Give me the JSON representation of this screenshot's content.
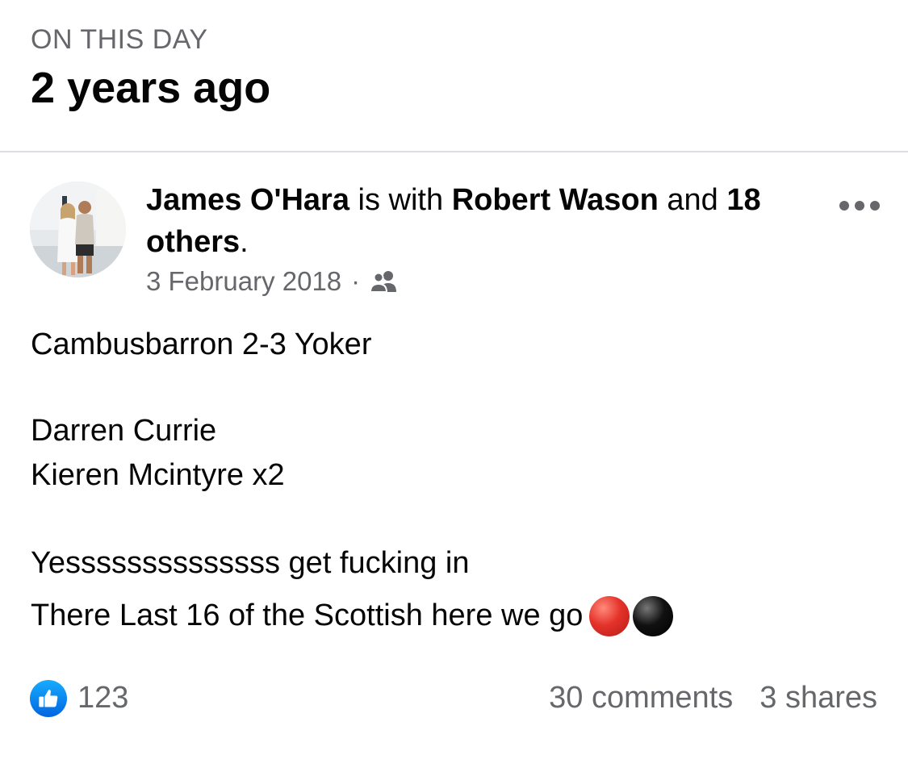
{
  "header": {
    "kicker": "ON THIS DAY",
    "title": "2 years ago"
  },
  "post": {
    "author": "James O'Hara",
    "with_text": "is with",
    "tagged_name": "Robert Wason",
    "and_text": "and",
    "others": "18 others",
    "period": ".",
    "date": "3 February 2018",
    "separator": "·",
    "audience_icon": "friends-icon",
    "more_icon": "more-options-icon",
    "lines": {
      "score": "Cambusbarron 2-3 Yoker",
      "scorer1": "Darren Currie",
      "scorer2": "Kieren Mcintyre x2",
      "cheer": "Yessssssssssssss get fucking in",
      "last": "There  Last 16 of the Scottish here we go"
    },
    "emojis": [
      "red-circle",
      "black-circle"
    ]
  },
  "reactions": {
    "icon": "like-thumb-icon",
    "count": "123",
    "comments": "30 comments",
    "shares": "3 shares"
  },
  "colors": {
    "secondary_text": "#65676b",
    "divider": "#dadde1",
    "like_blue": "#0165e1"
  }
}
